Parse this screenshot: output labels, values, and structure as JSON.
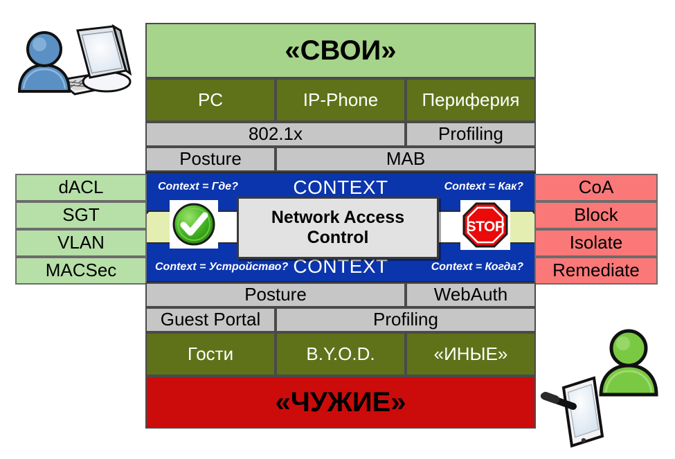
{
  "diagram": {
    "title_top": "«СВОИ»",
    "title_bottom": "«ЧУЖИЕ»",
    "center_box": "Network Access Control",
    "context_label": "CONTEXT",
    "context_top_left": "Context = Где?",
    "context_top_right": "Context = Как?",
    "context_bottom_left": "Context = Устройство?",
    "context_bottom_right": "Context = Когда?",
    "allow_icon": "green-check-icon",
    "deny_icon": "stop-sign-icon",
    "stop_text": "STOP",
    "top_rows": [
      {
        "cells": [
          {
            "label": "PC",
            "span": 1
          },
          {
            "label": "IP-Phone",
            "span": 1
          },
          {
            "label": "Периферия",
            "span": 1
          }
        ]
      },
      {
        "cells": [
          {
            "label": "802.1x",
            "span": 2
          },
          {
            "label": "Profiling",
            "span": 1
          }
        ]
      },
      {
        "cells": [
          {
            "label": "Posture",
            "span": 1
          },
          {
            "label": "MAB",
            "span": 2
          }
        ]
      }
    ],
    "bottom_rows": [
      {
        "cells": [
          {
            "label": "Posture",
            "span": 2
          },
          {
            "label": "WebAuth",
            "span": 1
          }
        ]
      },
      {
        "cells": [
          {
            "label": "Guest Portal",
            "span": 1
          },
          {
            "label": "Profiling",
            "span": 2
          }
        ]
      },
      {
        "cells": [
          {
            "label": "Гости",
            "span": 1
          },
          {
            "label": "B.Y.O.D.",
            "span": 1
          },
          {
            "label": "«ИНЫЕ»",
            "span": 1
          }
        ]
      }
    ],
    "left_panel": [
      "dACL",
      "SGT",
      "VLAN",
      "MACSec"
    ],
    "right_panel": [
      "CoA",
      "Block",
      "Isolate",
      "Remediate"
    ],
    "corner_art": {
      "top_left": "user-with-desktop-computer-icon",
      "bottom_right": "user-with-tablet-icon"
    },
    "colors": {
      "trusted_header": "#a6d48a",
      "untrusted_header": "#cc0b0b",
      "device_row": "#5f7219",
      "method_row": "#c6c6c6",
      "context_band": "#0b35ad",
      "left_panel": "#b7dfa8",
      "right_panel": "#fa7878",
      "arrow": "#e4eeb0",
      "nac_box": "#e2e2e2"
    }
  }
}
